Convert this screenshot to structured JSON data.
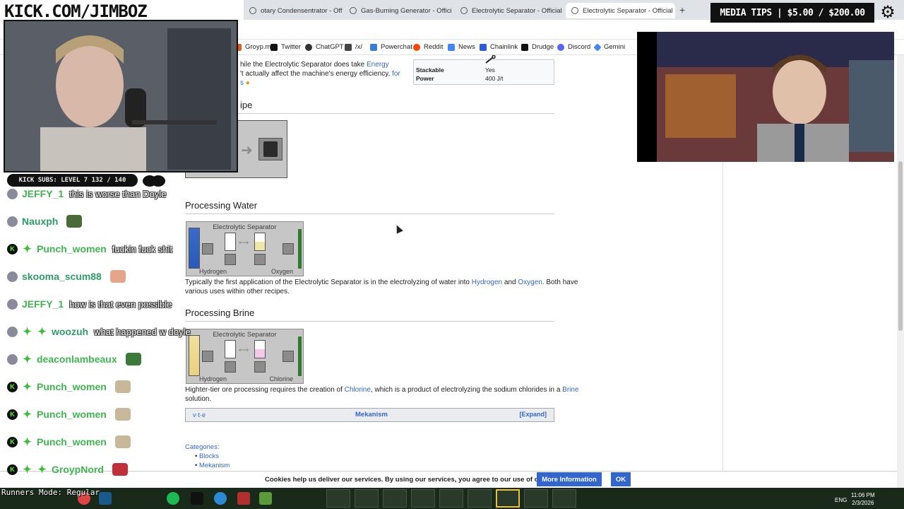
{
  "overlay": {
    "channel_banner": "KICK.COM/JIMBOZ",
    "media_tips": "MEDIA TIPS | $5.00 / $200.00",
    "subs_bar": "KICK SUBS: LEVEL 7 132 / 140",
    "runners_mode": "Runners Mode: Regular"
  },
  "browser": {
    "tabs": [
      {
        "title": "otary Condensentrator - Offic"
      },
      {
        "title": "Gas-Burning Generator - Offici"
      },
      {
        "title": "Electrolytic Separator - Official"
      },
      {
        "title": "Electrolytic Separator - Official"
      }
    ],
    "new_tab": "+",
    "bookmarks": [
      {
        "label": "Groyp.me",
        "color": "#e05a1a"
      },
      {
        "label": "Twitter",
        "color": "#111111"
      },
      {
        "label": "ChatGPT",
        "color": "#333333"
      },
      {
        "label": "/x/",
        "color": "#444444"
      },
      {
        "label": "Powerchat",
        "color": "#3a7bd5"
      },
      {
        "label": "Reddit",
        "color": "#ff4500"
      },
      {
        "label": "News",
        "color": "#4285f4"
      },
      {
        "label": "Chainlink",
        "color": "#2a5ada"
      },
      {
        "label": "Drudge",
        "color": "#111111"
      },
      {
        "label": "Discord",
        "color": "#5865f2"
      },
      {
        "label": "Gemini",
        "color": "#4285f4"
      }
    ]
  },
  "chat": [
    {
      "user": "JEFFY_1",
      "msg": "this is worse than Doyle",
      "color": "#3fb64f",
      "badges": [
        "avatar"
      ]
    },
    {
      "user": "Nauxph",
      "msg": "",
      "color": "#2f9a6a",
      "badges": [
        "avatar"
      ],
      "emote": "#4a6a3a"
    },
    {
      "user": "Punch_women",
      "msg": "fuckin fuck shit",
      "color": "#3fb64f",
      "badges": [
        "k",
        "star"
      ]
    },
    {
      "user": "skooma_scum88",
      "msg": "",
      "color": "#2f9a6a",
      "badges": [
        "avatar"
      ],
      "emote": "#e5a58a"
    },
    {
      "user": "JEFFY_1",
      "msg": "how is that even possible",
      "color": "#3fb64f",
      "badges": [
        "avatar"
      ]
    },
    {
      "user": "woozuh",
      "msg": "what happened w doyle",
      "color": "#2f9a6a",
      "badges": [
        "avatar",
        "star",
        "star"
      ]
    },
    {
      "user": "deaconlambeaux",
      "msg": "",
      "color": "#3fb64f",
      "badges": [
        "avatar",
        "star"
      ],
      "emote": "#3a7a3a"
    },
    {
      "user": "Punch_women",
      "msg": "",
      "color": "#3fb64f",
      "badges": [
        "k",
        "star"
      ],
      "emote": "#c8b89a"
    },
    {
      "user": "Punch_women",
      "msg": "",
      "color": "#3fb64f",
      "badges": [
        "k",
        "star"
      ],
      "emote": "#c8b89a"
    },
    {
      "user": "Punch_women",
      "msg": "",
      "color": "#3fb64f",
      "badges": [
        "k",
        "star"
      ],
      "emote": "#c8b89a"
    },
    {
      "user": "GroypNord",
      "msg": "",
      "color": "#3fb64f",
      "badges": [
        "k",
        "star",
        "star"
      ],
      "emote": "#c0303a"
    }
  ],
  "wiki": {
    "intro_line1_a": "hile the Electrolytic Separator does take ",
    "intro_line1_link": "Energy",
    "intro_line2_a": "'t actually affect the machine's energy efficiency, ",
    "intro_line2_link": "for",
    "intro_line3_link": "s",
    "infobox": [
      {
        "key": "Stackable",
        "value": "Yes"
      },
      {
        "key": "Power",
        "value": "400 J/t"
      }
    ],
    "recipe_heading": "ipe",
    "section_water": {
      "heading": "Processing Water",
      "gui_title": "Electrolytic Separator",
      "label_left": "Hydrogen",
      "label_right": "Oxygen",
      "text_a": "Typically the first application of the Electrolytic Separator is in the electrolyzing of water into ",
      "link_hydrogen": "Hydrogen",
      "text_and": " and ",
      "link_oxygen": "Oxygen",
      "text_b": ". Both have",
      "text_line2": "various uses within other recipes."
    },
    "section_brine": {
      "heading": "Processing Brine",
      "gui_title": "Electrolytic Separator",
      "label_left": "Hydrogen",
      "label_right": "Chlorine",
      "text_a": "Highter-tier ore processing requires the creation of ",
      "link_chlorine": "Chlorine",
      "text_b": ", which is a product of electrolyzing the sodium chlorides in a ",
      "link_brine": "Brine",
      "text_line2": "solution."
    },
    "navbox": {
      "vte": "v·t·e",
      "title": "Mekanism",
      "expand": "[Expand]"
    },
    "categories": {
      "label": "Categories:",
      "items": [
        "Blocks",
        "Mekanism"
      ]
    }
  },
  "cookie": {
    "text": "Cookies help us deliver our services. By using our services, you agree to our use of cookies.",
    "more": "More Information",
    "ok": "OK"
  },
  "taskbar": {
    "lang": "ENG",
    "time": "11:06 PM",
    "date": "2/3/2026"
  }
}
